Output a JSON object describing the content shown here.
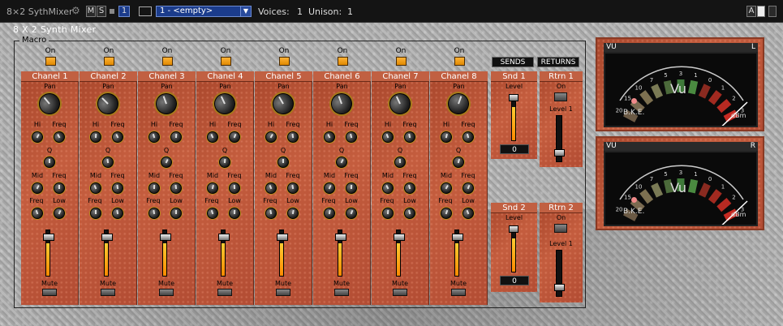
{
  "topbar": {
    "title": "8×2 SythMixer",
    "m": "M",
    "s": "S",
    "num": "1",
    "preset": "1 - <empty>",
    "voices_label": "Voices:",
    "voices": "1",
    "unison_label": "Unison:",
    "unison": "1",
    "a": "A"
  },
  "panel": {
    "title": "8 X 2 Synth Mixer",
    "macro": "Macro"
  },
  "channels": [
    {
      "on": "On",
      "name": "Chanel 1",
      "pan": "Pan",
      "hi": "Hi",
      "freq": "Freq",
      "q": "Q",
      "mid": "Mid",
      "freq2": "Freq",
      "freq3": "Freq",
      "low": "Low",
      "mute": "Mute",
      "level": 0.72
    },
    {
      "on": "On",
      "name": "Chanel 2",
      "pan": "Pan",
      "hi": "Hi",
      "freq": "Freq",
      "q": "Q",
      "mid": "Mid",
      "freq2": "Freq",
      "freq3": "Freq",
      "low": "Low",
      "mute": "Mute",
      "level": 0.72
    },
    {
      "on": "On",
      "name": "Chanel 3",
      "pan": "Pan",
      "hi": "Hi",
      "freq": "Freq",
      "q": "Q",
      "mid": "Mid",
      "freq2": "Freq",
      "freq3": "Freq",
      "low": "Low",
      "mute": "Mute",
      "level": 0.72
    },
    {
      "on": "On",
      "name": "Chanel 4",
      "pan": "Pan",
      "hi": "Hi",
      "freq": "Freq",
      "q": "Q",
      "mid": "Mid",
      "freq2": "Freq",
      "freq3": "Freq",
      "low": "Low",
      "mute": "Mute",
      "level": 0.72
    },
    {
      "on": "On",
      "name": "Chanel 5",
      "pan": "Pan",
      "hi": "Hi",
      "freq": "Freq",
      "q": "Q",
      "mid": "Mid",
      "freq2": "Freq",
      "freq3": "Freq",
      "low": "Low",
      "mute": "Mute",
      "level": 0.72
    },
    {
      "on": "On",
      "name": "Chanel 6",
      "pan": "Pan",
      "hi": "Hi",
      "freq": "Freq",
      "q": "Q",
      "mid": "Mid",
      "freq2": "Freq",
      "freq3": "Freq",
      "low": "Low",
      "mute": "Mute",
      "level": 0.72
    },
    {
      "on": "On",
      "name": "Chanel 7",
      "pan": "Pan",
      "hi": "Hi",
      "freq": "Freq",
      "q": "Q",
      "mid": "Mid",
      "freq2": "Freq",
      "freq3": "Freq",
      "low": "Low",
      "mute": "Mute",
      "level": 0.72
    },
    {
      "on": "On",
      "name": "Chanel 8",
      "pan": "Pan",
      "hi": "Hi",
      "freq": "Freq",
      "q": "Q",
      "mid": "Mid",
      "freq2": "Freq",
      "freq3": "Freq",
      "low": "Low",
      "mute": "Mute",
      "level": 0.72
    }
  ],
  "sends": {
    "label": "SENDS",
    "snd1": "Snd 1",
    "snd2": "Snd 2",
    "level": "Level",
    "value1": "0",
    "value2": "0"
  },
  "returns": {
    "label": "RETURNS",
    "rtrn1": "Rtrn 1",
    "rtrn2": "Rtrn 2",
    "on": "On",
    "level1": "Level 1",
    "level2": "Level 1"
  },
  "vu": [
    {
      "label": "VU",
      "side": "L",
      "brand": "B.K.E.",
      "unit": "dBm",
      "title": "Vu"
    },
    {
      "label": "VU",
      "side": "R",
      "brand": "B.K.E.",
      "unit": "dBm",
      "title": "Vu"
    }
  ],
  "vu_scale": [
    "20",
    "15",
    "10",
    "7",
    "5",
    "3",
    "1",
    "0",
    "1",
    "2",
    "3"
  ],
  "colors": {
    "accent": "#ffa000",
    "panel": "#b85235",
    "preset": "#1b3c8c"
  }
}
